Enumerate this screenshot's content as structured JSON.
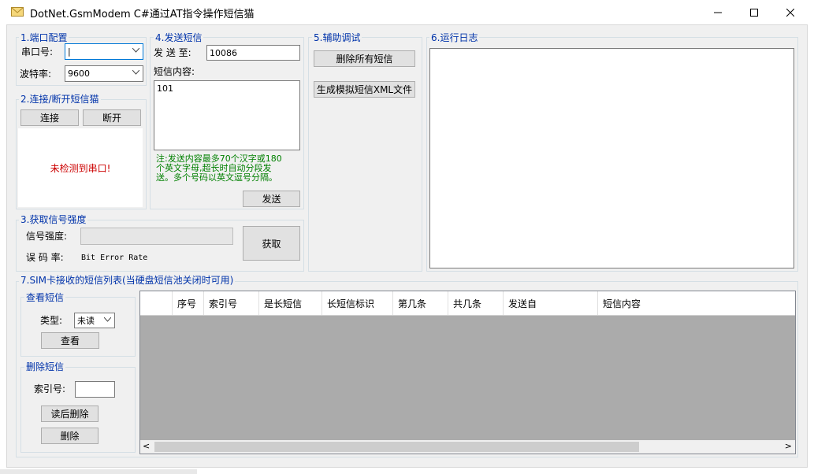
{
  "window": {
    "title": "DotNet.GsmModem C#通过AT指令操作短信猫",
    "buttons": {
      "minimize": "—",
      "maximize": "☐",
      "close": "✕"
    }
  },
  "port_config": {
    "title": "1.端口配置",
    "port_label": "串口号:",
    "port_value": "|",
    "baud_label": "波特率:",
    "baud_value": "9600"
  },
  "connect": {
    "title": "2.连接/断开短信猫",
    "connect_label": "连接",
    "disconnect_label": "断开",
    "status_text": "未检测到串口!",
    "status_color": "#cc0000"
  },
  "signal": {
    "title": "3.获取信号强度",
    "strength_label": "信号强度:",
    "error_rate_label": "误 码 率:",
    "error_rate_value": "Bit Error Rate",
    "get_label": "获取"
  },
  "send_sms": {
    "title": "4.发送短信",
    "to_label": "发 送 至:",
    "to_value": "10086",
    "content_label": "短信内容:",
    "content_value": "101",
    "note_line1": "注:发送内容最多70个汉字或180",
    "note_line2": "个英文字母,超长时自动分段发",
    "note_line3": "送。多个号码以英文逗号分隔。",
    "note_color": "#008000",
    "send_label": "发送"
  },
  "assist": {
    "title": "5.辅助调试",
    "delete_all_label": "删除所有短信",
    "gen_xml_label": "生成模拟短信XML文件"
  },
  "log": {
    "title": "6.运行日志"
  },
  "sim_list": {
    "title": "7.SIM卡接收的短信列表(当硬盘短信池关闭时可用)",
    "view_group": "查看短信",
    "type_label": "类型:",
    "type_value": "未读",
    "view_label": "查看",
    "delete_group": "删除短信",
    "index_label": "索引号:",
    "read_delete_label": "读后删除",
    "delete_label": "删除",
    "columns": [
      "序号",
      "索引号",
      "是长短信",
      "长短信标识",
      "第几条",
      "共几条",
      "发送自",
      "短信内容"
    ],
    "scroll_left": "<",
    "scroll_right": ">"
  },
  "colors": {
    "group_title": "#0033aa",
    "grid_bg": "#ababab"
  }
}
